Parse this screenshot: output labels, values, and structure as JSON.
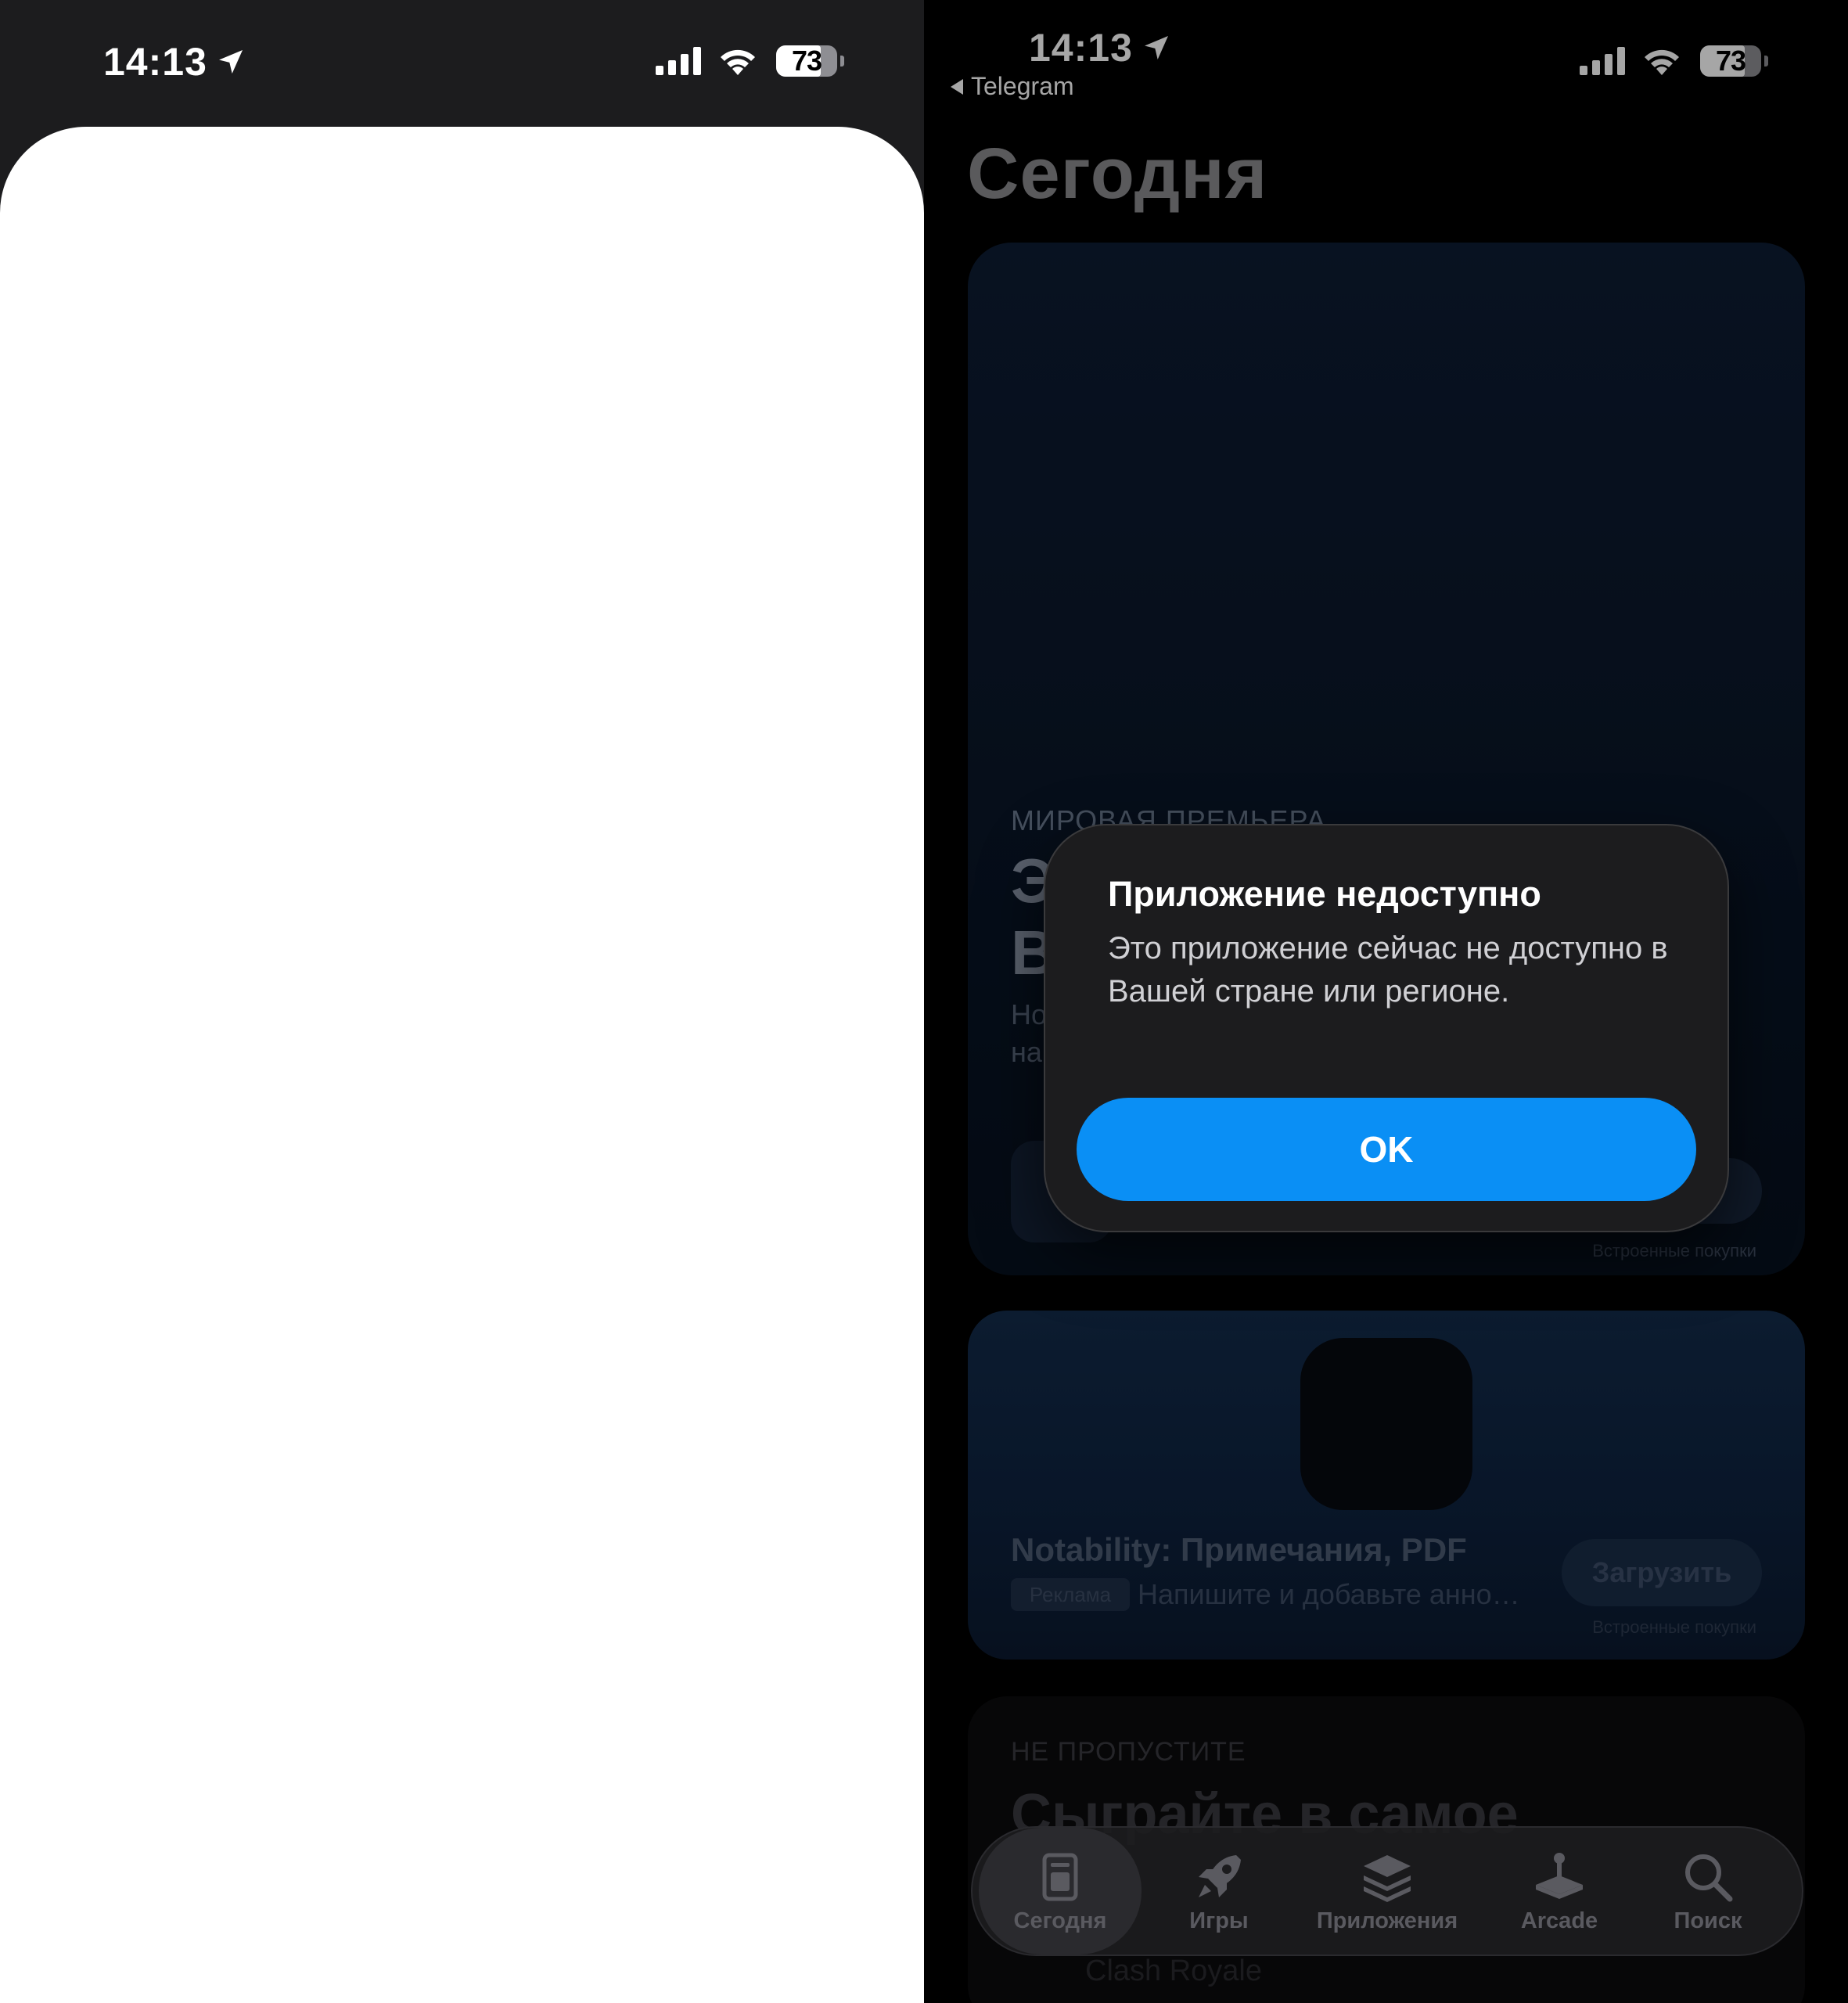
{
  "left_screen": {
    "status_bar": {
      "time": "14:13",
      "battery": "73"
    }
  },
  "right_screen": {
    "status_bar": {
      "time": "14:13",
      "battery": "73"
    },
    "back_link": "Telegram",
    "page_title": "Сегодня",
    "featured_card": {
      "eyebrow": "МИРОВАЯ ПРЕМЬЕРА",
      "title_line1": "Э",
      "title_line2": "В",
      "subtitle_line1": "Но",
      "subtitle_line2": "на",
      "in_app_purchases": "Встроенные покупки"
    },
    "ad_card": {
      "app_name": "Notability: Примечания, PDF",
      "ad_badge": "Реклама",
      "ad_text": "Напишите и добавьте анно…",
      "download_button": "Загрузить",
      "in_app_purchases": "Встроенные покупки"
    },
    "promo_card": {
      "eyebrow": "НЕ ПРОПУСТИТЕ",
      "title": "Сыграйте в самое",
      "app_name": "Clash Royale"
    },
    "tab_bar": {
      "tabs": [
        {
          "label": "Сегодня",
          "icon": "today-icon",
          "active": true
        },
        {
          "label": "Игры",
          "icon": "rocket-icon",
          "active": false
        },
        {
          "label": "Приложения",
          "icon": "layers-icon",
          "active": false
        },
        {
          "label": "Arcade",
          "icon": "joystick-icon",
          "active": false
        },
        {
          "label": "Поиск",
          "icon": "search-icon",
          "active": false
        }
      ]
    },
    "alert": {
      "title": "Приложение недоступно",
      "message": "Это приложение сейчас не доступно в Вашей стране или регионе.",
      "ok_button": "OK"
    }
  },
  "colors": {
    "accent_blue": "#0a8ff5",
    "background": "#000000",
    "sheet_white": "#ffffff"
  }
}
